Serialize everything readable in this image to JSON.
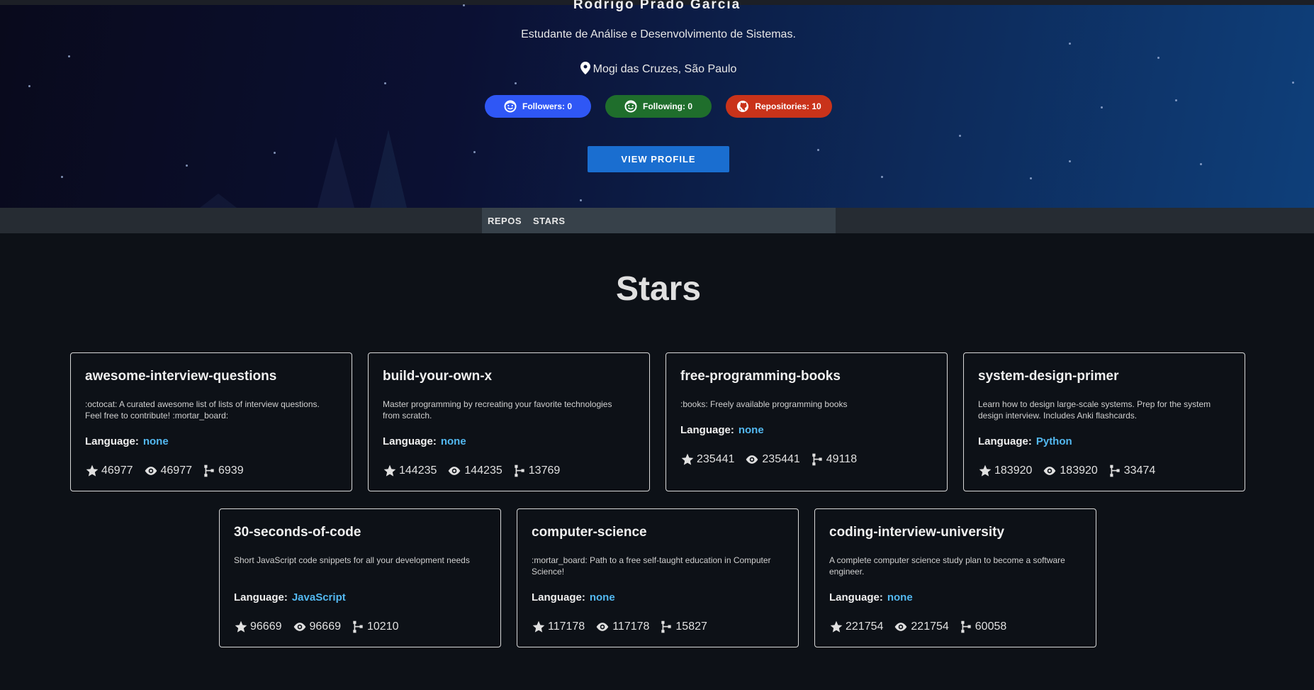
{
  "profile": {
    "name": "Rodrigo Prado Garcia",
    "subtitle": "Estudante de Análise e Desenvolvimento de Sistemas.",
    "location": "Mogi das Cruzes, São Paulo",
    "followers_label": "Followers: 0",
    "following_label": "Following: 0",
    "repositories_label": "Repositories: 10",
    "view_profile_label": "VIEW PROFILE"
  },
  "tabs": [
    {
      "label": "REPOS"
    },
    {
      "label": "STARS"
    }
  ],
  "section_title": "Stars",
  "colors": {
    "followers_badge": "#2f57f5",
    "following_badge": "#1f6e2c",
    "repositories_badge": "#c9331a",
    "view_profile_button": "#1a6ed0",
    "language_value": "#53b8f0"
  },
  "cards": [
    {
      "name": "awesome-interview-questions",
      "description": ":octocat: A curated awesome list of lists of interview questions. Feel free to contribute! :mortar_board:",
      "language_label": "Language:",
      "language": "none",
      "stars": "46977",
      "watchers": "46977",
      "forks": "6939"
    },
    {
      "name": "build-your-own-x",
      "description": "Master programming by recreating your favorite technologies from scratch.",
      "language_label": "Language:",
      "language": "none",
      "stars": "144235",
      "watchers": "144235",
      "forks": "13769"
    },
    {
      "name": "free-programming-books",
      "description": ":books: Freely available programming books",
      "language_label": "Language:",
      "language": "none",
      "stars": "235441",
      "watchers": "235441",
      "forks": "49118"
    },
    {
      "name": "system-design-primer",
      "description": "Learn how to design large-scale systems. Prep for the system design interview. Includes Anki flashcards.",
      "language_label": "Language:",
      "language": "Python",
      "stars": "183920",
      "watchers": "183920",
      "forks": "33474"
    },
    {
      "name": "30-seconds-of-code",
      "description": "Short JavaScript code snippets for all your development needs",
      "language_label": "Language:",
      "language": "JavaScript",
      "stars": "96669",
      "watchers": "96669",
      "forks": "10210"
    },
    {
      "name": "computer-science",
      "description": ":mortar_board: Path to a free self-taught education in Computer Science!",
      "language_label": "Language:",
      "language": "none",
      "stars": "117178",
      "watchers": "117178",
      "forks": "15827"
    },
    {
      "name": "coding-interview-university",
      "description": "A complete computer science study plan to become a software engineer.",
      "language_label": "Language:",
      "language": "none",
      "stars": "221754",
      "watchers": "221754",
      "forks": "60058"
    }
  ]
}
